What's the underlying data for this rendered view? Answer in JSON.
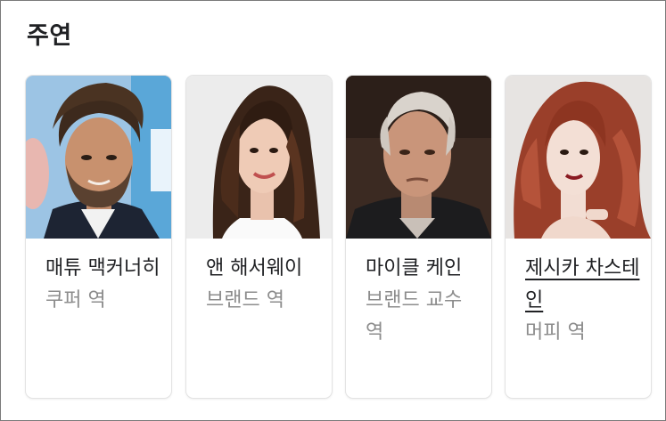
{
  "section": {
    "title": "주연"
  },
  "cast": [
    {
      "name": "매튜 맥커너히",
      "role": "쿠퍼 역",
      "photo_icon": "actor-photo-bearded-man"
    },
    {
      "name": "앤 해서웨이",
      "role": "브랜드 역",
      "photo_icon": "actor-photo-dark-hair-woman"
    },
    {
      "name": "마이클 케인",
      "role": "브랜드 교수 역",
      "photo_icon": "actor-photo-older-man"
    },
    {
      "name": "제시카 차스테인",
      "role": "머피 역",
      "photo_icon": "actor-photo-red-hair-woman"
    }
  ],
  "colors": {
    "title_text": "#202124",
    "role_text": "#8c8c8c",
    "frame_border": "#7a7a7a"
  }
}
